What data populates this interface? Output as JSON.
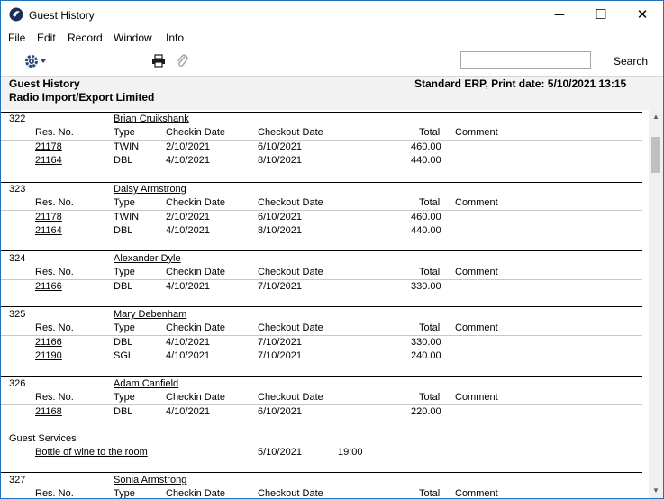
{
  "window": {
    "title": "Guest History",
    "minimize": "─",
    "maximize": "☐",
    "close": "✕"
  },
  "menu": [
    "File",
    "Edit",
    "Record",
    "Window",
    "Info"
  ],
  "toolbar": {
    "search_value": "",
    "search_label": "Search"
  },
  "header": {
    "title": "Guest History",
    "company": "Radio Import/Export Limited",
    "right": "Standard ERP, Print date: 5/10/2021 13:15"
  },
  "columns": {
    "res_no": "Res. No.",
    "type": "Type",
    "checkin": "Checkin Date",
    "checkout": "Checkout Date",
    "total": "Total",
    "comment": "Comment"
  },
  "guests": [
    {
      "id": "322",
      "name": "Brian Cruikshank",
      "rows": [
        {
          "res": "21178",
          "type": "TWIN",
          "in": "2/10/2021",
          "out": "6/10/2021",
          "total": "460.00"
        },
        {
          "res": "21164",
          "type": "DBL",
          "in": "4/10/2021",
          "out": "8/10/2021",
          "total": "440.00"
        }
      ]
    },
    {
      "id": "323",
      "name": "Daisy Armstrong",
      "rows": [
        {
          "res": "21178",
          "type": "TWIN",
          "in": "2/10/2021",
          "out": "6/10/2021",
          "total": "460.00"
        },
        {
          "res": "21164",
          "type": "DBL",
          "in": "4/10/2021",
          "out": "8/10/2021",
          "total": "440.00"
        }
      ]
    },
    {
      "id": "324",
      "name": "Alexander Dyle",
      "rows": [
        {
          "res": "21166",
          "type": "DBL",
          "in": "4/10/2021",
          "out": "7/10/2021",
          "total": "330.00"
        }
      ]
    },
    {
      "id": "325",
      "name": "Mary Debenham",
      "rows": [
        {
          "res": "21166",
          "type": "DBL",
          "in": "4/10/2021",
          "out": "7/10/2021",
          "total": "330.00"
        },
        {
          "res": "21190",
          "type": "SGL",
          "in": "4/10/2021",
          "out": "7/10/2021",
          "total": "240.00"
        }
      ]
    },
    {
      "id": "326",
      "name": "Adam Canfield",
      "rows": [
        {
          "res": "21168",
          "type": "DBL",
          "in": "4/10/2021",
          "out": "6/10/2021",
          "total": "220.00"
        }
      ],
      "services_label": "Guest Services",
      "services": [
        {
          "desc": "Bottle of wine to the room",
          "date": "5/10/2021",
          "time": "19:00"
        }
      ]
    },
    {
      "id": "327",
      "name": "Sonia Armstrong",
      "rows": []
    }
  ]
}
